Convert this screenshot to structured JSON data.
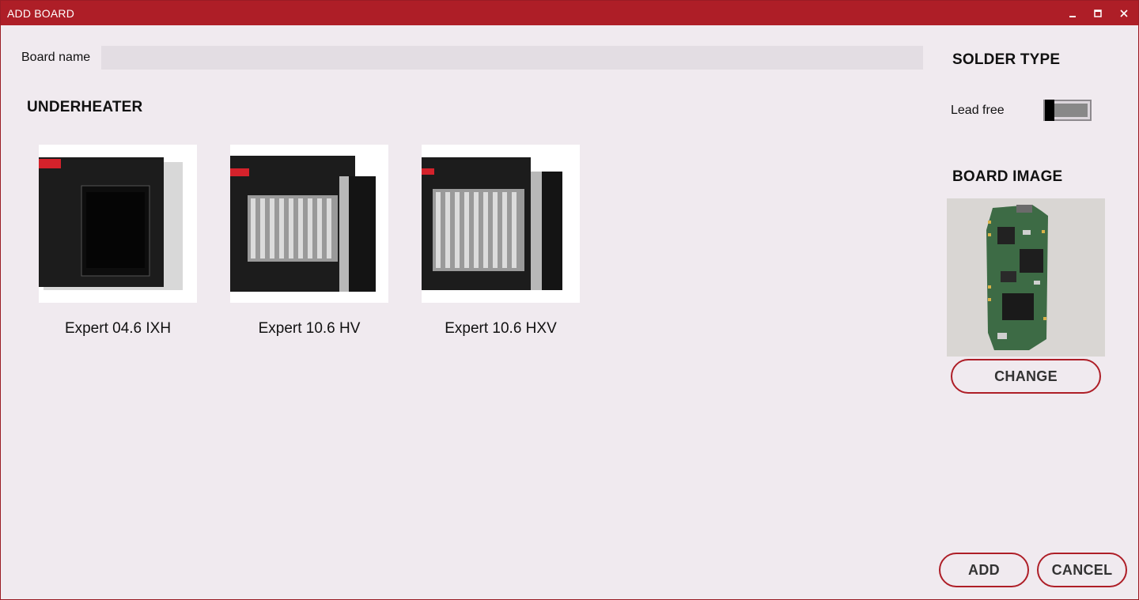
{
  "window": {
    "title": "ADD BOARD",
    "controls": {
      "minimize": "minimize-icon",
      "maximize": "maximize-icon",
      "close": "close-icon"
    },
    "accent_color": "#ae1e27",
    "background_color": "#f0eaef"
  },
  "form": {
    "board_name_label": "Board name",
    "board_name_value": "",
    "board_name_placeholder": ""
  },
  "underheater": {
    "heading": "UNDERHEATER",
    "items": [
      {
        "name": "Expert 04.6 IXH"
      },
      {
        "name": "Expert 10.6 HV"
      },
      {
        "name": "Expert 10.6 HXV"
      }
    ]
  },
  "solder_type": {
    "heading": "SOLDER TYPE",
    "option_label": "Lead free",
    "toggle_on": false
  },
  "board_image": {
    "heading": "BOARD IMAGE",
    "change_label": "CHANGE"
  },
  "footer": {
    "add_label": "ADD",
    "cancel_label": "CANCEL"
  }
}
